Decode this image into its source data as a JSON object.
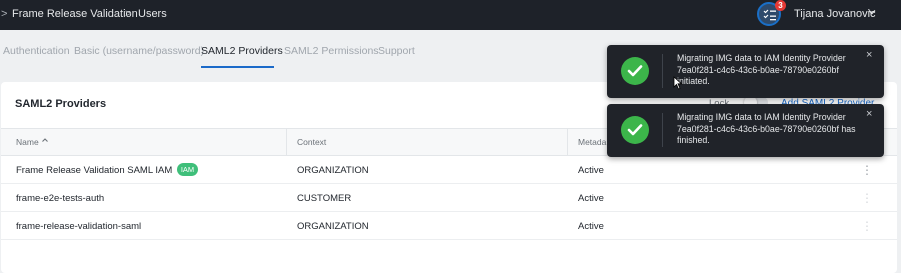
{
  "breadcrumb": {
    "prefix": ">",
    "app": "Frame Release Validation",
    "separator": ">",
    "section": "Users"
  },
  "header": {
    "notification_count": "3",
    "user_name": "Tijana Jovanovic",
    "icons": {
      "notifications": "checklist-icon",
      "user_menu": "chevron-down-icon"
    }
  },
  "tabs": [
    {
      "label": "Authentication",
      "active": false
    },
    {
      "label": "Basic (username/password)",
      "active": false
    },
    {
      "label": "SAML2 Providers",
      "active": true
    },
    {
      "label": "SAML2 Permissions",
      "active": false
    },
    {
      "label": "Support",
      "active": false
    }
  ],
  "panel": {
    "title": "SAML2 Providers",
    "lock_label": "Lock",
    "add_label": "Add SAML2 Provider"
  },
  "table": {
    "columns": [
      "Name",
      "Context",
      "Metada"
    ],
    "rows": [
      {
        "name": "Frame Release Validation SAML IAM",
        "badge": "IAM",
        "context": "ORGANIZATION",
        "status": "Active"
      },
      {
        "name": "frame-e2e-tests-auth",
        "badge": "",
        "context": "CUSTOMER",
        "status": "Active"
      },
      {
        "name": "frame-release-validation-saml",
        "badge": "",
        "context": "ORGANIZATION",
        "status": "Active"
      }
    ]
  },
  "toasts": [
    {
      "message": "Migrating IMG data to IAM Identity Provider 7ea0f281-c4c6-43c6-b0ae-78790e0260bf initiated.",
      "close": "×"
    },
    {
      "message": "Migrating IMG data to IAM Identity Provider 7ea0f281-c4c6-43c6-b0ae-78790e0260bf has finished.",
      "close": "×"
    }
  ],
  "colors": {
    "accent": "#1b6ac9",
    "success": "#3cb54a",
    "badge": "#3fbf7a",
    "topbar": "#1e2229",
    "alert": "#e53935"
  }
}
